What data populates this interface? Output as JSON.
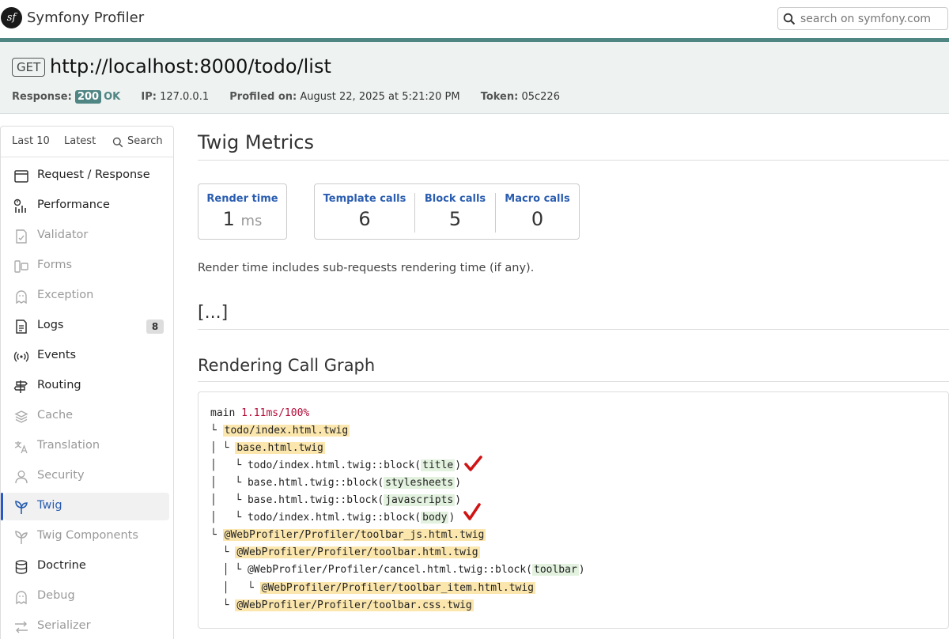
{
  "header": {
    "logo_text": "sf",
    "title": "Symfony Profiler",
    "search_placeholder": "search on symfony.com"
  },
  "summary": {
    "method": "GET",
    "url": "http://localhost:8000/todo/list",
    "response_label": "Response:",
    "status_code": "200",
    "status_text": "OK",
    "ip_label": "IP:",
    "ip": "127.0.0.1",
    "profiled_label": "Profiled on:",
    "profiled_on": "August 22, 2025 at 5:21:20 PM",
    "token_label": "Token:",
    "token": "05c226"
  },
  "sidebar": {
    "tabs": [
      "Last 10",
      "Latest",
      "Search"
    ],
    "items": [
      {
        "label": "Request / Response",
        "icon": "request-icon"
      },
      {
        "label": "Performance",
        "icon": "performance-icon"
      },
      {
        "label": "Validator",
        "icon": "validator-icon",
        "disabled": true
      },
      {
        "label": "Forms",
        "icon": "forms-icon",
        "disabled": true
      },
      {
        "label": "Exception",
        "icon": "exception-icon",
        "disabled": true
      },
      {
        "label": "Logs",
        "icon": "logs-icon",
        "badge": "8"
      },
      {
        "label": "Events",
        "icon": "events-icon"
      },
      {
        "label": "Routing",
        "icon": "routing-icon"
      },
      {
        "label": "Cache",
        "icon": "cache-icon",
        "disabled": true
      },
      {
        "label": "Translation",
        "icon": "translation-icon",
        "disabled": true
      },
      {
        "label": "Security",
        "icon": "security-icon",
        "disabled": true
      },
      {
        "label": "Twig",
        "icon": "twig-icon",
        "active": true
      },
      {
        "label": "Twig Components",
        "icon": "twig-components-icon",
        "disabled": true
      },
      {
        "label": "Doctrine",
        "icon": "doctrine-icon"
      },
      {
        "label": "Debug",
        "icon": "debug-icon",
        "disabled": true
      },
      {
        "label": "Serializer",
        "icon": "serializer-icon",
        "disabled": true
      }
    ]
  },
  "main": {
    "title": "Twig Metrics",
    "render_time": {
      "label": "Render time",
      "value": "1",
      "unit": "ms"
    },
    "template_calls": {
      "label": "Template calls",
      "value": "6"
    },
    "block_calls": {
      "label": "Block calls",
      "value": "5"
    },
    "macro_calls": {
      "label": "Macro calls",
      "value": "0"
    },
    "note": "Render time includes sub-requests rendering time (if any).",
    "ellipsis": "[...]",
    "graph_title": "Rendering Call Graph",
    "graph": {
      "root": "main",
      "root_time": "1.11ms/100%",
      "templates": {
        "t1": "todo/index.html.twig",
        "t2": "base.html.twig",
        "t3": "@WebProfiler/Profiler/toolbar_js.html.twig",
        "t4": "@WebProfiler/Profiler/toolbar.html.twig",
        "t5": "@WebProfiler/Profiler/toolbar_item.html.twig",
        "t6": "@WebProfiler/Profiler/toolbar.css.twig"
      },
      "blocks": {
        "b1_prefix": "todo/index.html.twig::block(",
        "b1_name": "title",
        "b2_prefix": "base.html.twig::block(",
        "b2_name": "stylesheets",
        "b3_prefix": "base.html.twig::block(",
        "b3_name": "javascripts",
        "b4_prefix": "todo/index.html.twig::block(",
        "b4_name": "body",
        "b5_prefix": "@WebProfiler/Profiler/cancel.html.twig::block(",
        "b5_name": "toolbar"
      },
      "close_paren": ")"
    }
  }
}
